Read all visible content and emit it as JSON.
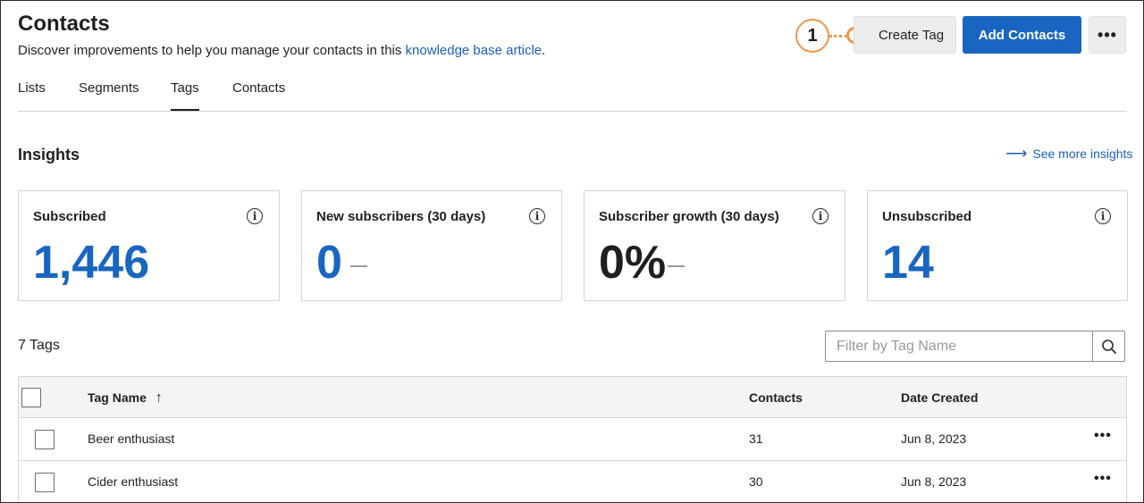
{
  "header": {
    "title": "Contacts",
    "subtitle_text": "Discover improvements to help you manage your contacts in this ",
    "subtitle_link": "knowledge base article",
    "subtitle_end": ".",
    "callout_number": "1",
    "create_tag_label": "Create Tag",
    "add_contacts_label": "Add Contacts",
    "more_label": "•••"
  },
  "tabs": [
    {
      "label": "Lists",
      "active": false
    },
    {
      "label": "Segments",
      "active": false
    },
    {
      "label": "Tags",
      "active": true
    },
    {
      "label": "Contacts",
      "active": false
    }
  ],
  "insights": {
    "title": "Insights",
    "see_more": "See more insights",
    "cards": [
      {
        "label": "Subscribed",
        "value": "1,446"
      },
      {
        "label": "New subscribers (30 days)",
        "value": "0"
      },
      {
        "label": "Subscriber growth (30 days)",
        "value": "0%"
      },
      {
        "label": "Unsubscribed",
        "value": "14"
      }
    ]
  },
  "tags": {
    "count": "7 Tags",
    "filter_placeholder": "Filter by Tag Name",
    "columns": [
      "Tag Name",
      "Contacts",
      "Date Created"
    ],
    "sort_arrow": "↑",
    "rows": [
      {
        "name": "Beer enthusiast",
        "contacts": "31",
        "date": "Jun 8, 2023"
      },
      {
        "name": "Cider enthusiast",
        "contacts": "30",
        "date": "Jun 8, 2023"
      }
    ],
    "row_more": "•••"
  },
  "colors": {
    "accent": "#1866c1",
    "link": "#1a5fba",
    "callout": "#f0954a"
  }
}
